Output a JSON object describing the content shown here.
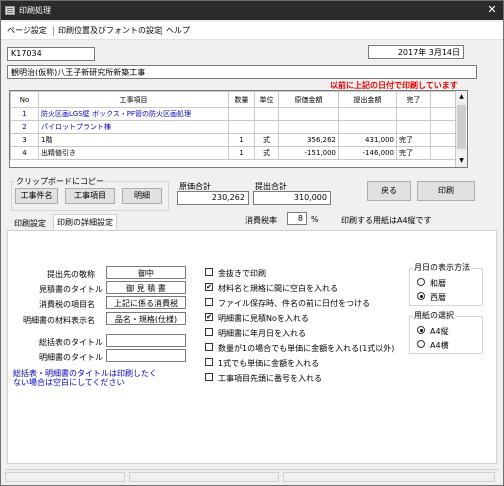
{
  "window": {
    "title": "印刷処理",
    "close_glyph": "✕"
  },
  "menu": [
    "ページ設定",
    "印刷位置及びフォントの設定",
    "ヘルプ"
  ],
  "header": {
    "code": "K17034",
    "date": "2017年 3月14日",
    "project_name": "観明治(仮称)八王子新研究所新築工事",
    "warning": "以前に上記の日付で印刷しています"
  },
  "grid": {
    "columns": [
      "No",
      "工事項目",
      "数量",
      "単位",
      "原価金額",
      "提出金額",
      "完了"
    ],
    "rows": [
      [
        "1",
        "防火区画LGS壁 ボックス・PF管の防火区画処理",
        "",
        "",
        "",
        "",
        ""
      ],
      [
        "2",
        "パイロットプラント棟",
        "",
        "",
        "",
        "",
        ""
      ],
      [
        "3",
        "1階",
        "1",
        "式",
        "356,262",
        "431,000",
        "完了"
      ],
      [
        "4",
        "出精値引き",
        "1",
        "式",
        "-151,000",
        "-146,000",
        "完了"
      ]
    ],
    "scroll_up": "▲",
    "scroll_down": "▼"
  },
  "clipboard": {
    "label": "クリップボードにコピー",
    "buttons": [
      "工事件名",
      "工事項目",
      "明細"
    ]
  },
  "totals": {
    "cost_label": "原価合計",
    "cost_value": "230,262",
    "submit_label": "提出合計",
    "submit_value": "310,000"
  },
  "actions": {
    "back": "戻る",
    "print": "印刷"
  },
  "tabs": [
    "印刷設定",
    "印刷の詳細設定"
  ],
  "tax": {
    "label": "消費税率",
    "value": "8",
    "unit": "%"
  },
  "paper_note": "印刷する用紙はA4縦です",
  "form": {
    "addressee_label": "提出先の敬称",
    "addressee_value": "御中",
    "estimate_title_label": "見積書のタイトル",
    "estimate_title_value": "御 見 積 書",
    "tax_item_label": "消費税の項目名",
    "tax_item_value": "上記に係る消費税",
    "detail_name_label": "明細書の材料表示名",
    "detail_name_value": "品名・規格(仕様)",
    "summary_title_label": "総括表のタイトル",
    "summary_title_value": "",
    "detail_title_label": "明細書のタイトル",
    "detail_title_value": "",
    "note": "総括表・明細書のタイトルは印刷したくない場合は空白にしてください"
  },
  "options": [
    {
      "label": "金抜きで印刷",
      "checked": false
    },
    {
      "label": "材料名と規格に間に空白を入れる",
      "checked": true
    },
    {
      "label": "ファイル保存時、件名の前に日付をつける",
      "checked": false
    },
    {
      "label": "明細書に見積Noを入れる",
      "checked": true
    },
    {
      "label": "明細書に年月日を入れる",
      "checked": false
    },
    {
      "label": "数量が1の場合でも単価に金額を入れる(1式以外)",
      "checked": false
    },
    {
      "label": "1式でも単価に金額を入れる",
      "checked": false
    },
    {
      "label": "工事項目先頭に番号を入れる",
      "checked": false
    }
  ],
  "date_display": {
    "label": "月日の表示方法",
    "options": [
      {
        "label": "和暦",
        "selected": false
      },
      {
        "label": "西暦",
        "selected": true
      }
    ]
  },
  "paper_select": {
    "label": "用紙の選択",
    "options": [
      {
        "label": "A4縦",
        "selected": true
      },
      {
        "label": "A4横",
        "selected": false
      }
    ]
  }
}
